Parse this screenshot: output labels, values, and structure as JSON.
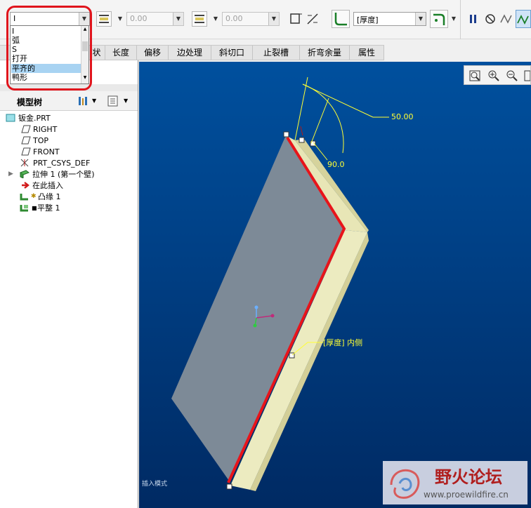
{
  "toolbar": {
    "shape_combo_value": "I",
    "length_value_1": "0.00",
    "length_value_2": "0.00",
    "thickness_combo_value": "[厚度]"
  },
  "dropdown": {
    "options": [
      "I",
      "弧",
      "S",
      "打开",
      "平齐的",
      "鸭形"
    ],
    "selected_index": 4
  },
  "tabs": [
    "状",
    "长度",
    "偏移",
    "边处理",
    "斜切口",
    "止裂槽",
    "折弯余量",
    "属性"
  ],
  "model_tree": {
    "title": "模型树",
    "items": [
      {
        "label": "钣金.PRT",
        "icon": "part-icon"
      },
      {
        "label": "RIGHT",
        "icon": "datum-plane-icon"
      },
      {
        "label": "TOP",
        "icon": "datum-plane-icon"
      },
      {
        "label": "FRONT",
        "icon": "datum-plane-icon"
      },
      {
        "label": "PRT_CSYS_DEF",
        "icon": "csys-icon"
      },
      {
        "label": "拉伸 1 (第一个壁)",
        "icon": "extrude-wall-icon"
      },
      {
        "label": "在此插入",
        "icon": "insert-arrow-icon"
      },
      {
        "label": "凸缘 1",
        "icon": "flange-icon"
      },
      {
        "label": "平整 1",
        "icon": "flat-wall-icon"
      }
    ]
  },
  "viewport": {
    "dim_length": "50.00",
    "dim_angle": "90.0",
    "thickness_label": "[厚度] 内侧",
    "mode_text": "插入模式"
  },
  "watermark": {
    "title": "野火论坛",
    "url": "www.proewildfire.cn"
  },
  "colors": {
    "viewport_top": "#00509e",
    "viewport_bottom": "#002a63",
    "highlight": "#e0141c",
    "edge_red": "#e8141a",
    "flange": "#e8e6b6",
    "plate": "#7d8a97",
    "dim_yellow": "#ffff33"
  }
}
